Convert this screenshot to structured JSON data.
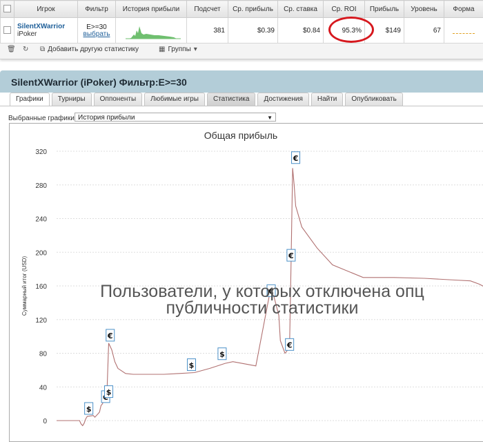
{
  "table": {
    "headers": [
      "",
      "Игрок",
      "Фильтр",
      "История прибыли",
      "Подсчет",
      "Ср. прибыль",
      "Ср. ставка",
      "Ср. ROI",
      "Прибыль",
      "Уровень",
      "Форма"
    ],
    "row": {
      "player_name": "SilentXWarrior",
      "player_site": "iPoker",
      "filter_value": "E>=30",
      "filter_link": "выбрать",
      "count": "381",
      "avg_profit": "$0.39",
      "avg_stake": "$0.84",
      "avg_roi": "95.3%",
      "profit": "$149",
      "level": "67"
    }
  },
  "toolbar": {
    "add_stat": "Добавить другую статистику",
    "groups": "Группы"
  },
  "panel": {
    "title": "SilentXWarrior (iPoker) Фильтр:E>=30",
    "tabs": [
      "Графики",
      "Турниры",
      "Оппоненты",
      "Любимые игры",
      "Статистика",
      "Достижения",
      "Найти",
      "Опубликовать"
    ]
  },
  "selector": {
    "label": "Выбранные графики:",
    "value": "История прибыли"
  },
  "overlay": {
    "line1": "Пользователи, у которых отключена опц",
    "line2": "публичности статистики"
  },
  "chart_data": {
    "type": "line",
    "title": "Общая прибыль",
    "ylabel": "Суммарный итог (USD)",
    "ylim": [
      0,
      320
    ],
    "yticks": [
      0,
      40,
      80,
      120,
      160,
      200,
      240,
      280,
      320
    ],
    "grid": true,
    "colors": {
      "line": "#b07070",
      "grid": "#dddddd",
      "marker_border": "#4a90c8"
    },
    "x": [
      0,
      8,
      15,
      16,
      17,
      18,
      19,
      20,
      24,
      25,
      27,
      28,
      29,
      30,
      31,
      32,
      33,
      34,
      36,
      38,
      40,
      45,
      50,
      56,
      70,
      80,
      90,
      100,
      110,
      115,
      130,
      140,
      145,
      146,
      149,
      150,
      151,
      152,
      153,
      154,
      155,
      156,
      160,
      170,
      180,
      200,
      220,
      240,
      260,
      270,
      276,
      280
    ],
    "y": [
      0,
      0,
      0,
      -4,
      -6,
      -3,
      2,
      5,
      6,
      4,
      8,
      10,
      18,
      20,
      27,
      34,
      40,
      92,
      84,
      70,
      62,
      56,
      55,
      55,
      55,
      56,
      57,
      62,
      68,
      70,
      65,
      160,
      125,
      95,
      80,
      82,
      85,
      90,
      190,
      300,
      280,
      255,
      230,
      205,
      185,
      170,
      170,
      169,
      167,
      166,
      162,
      158
    ],
    "markers": [
      {
        "x": 21,
        "y": 14,
        "label": "$"
      },
      {
        "x": 32,
        "y": 28,
        "label": "€"
      },
      {
        "x": 34,
        "y": 34,
        "label": "$"
      },
      {
        "x": 35,
        "y": 101,
        "label": "€"
      },
      {
        "x": 88,
        "y": 66,
        "label": "$"
      },
      {
        "x": 108,
        "y": 79,
        "label": "$"
      },
      {
        "x": 140,
        "y": 154,
        "label": "€"
      },
      {
        "x": 152,
        "y": 90,
        "label": "€"
      },
      {
        "x": 153,
        "y": 196,
        "label": "€"
      },
      {
        "x": 156,
        "y": 312,
        "label": "€"
      }
    ]
  }
}
